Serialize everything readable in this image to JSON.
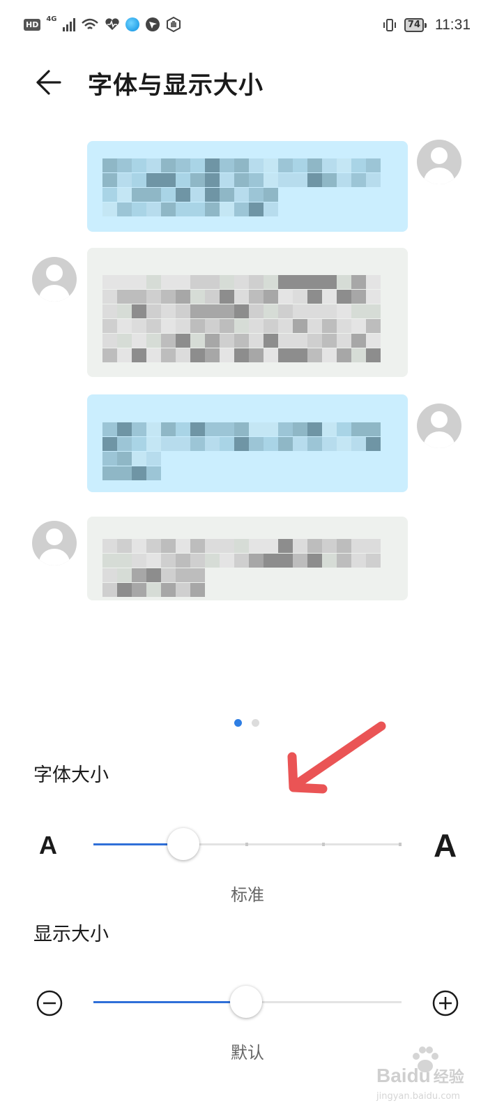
{
  "status_bar": {
    "network_badge": "HD",
    "network_type": "4G",
    "battery": "74",
    "time": "11:31",
    "icons": [
      "hd-icon",
      "signal-icon",
      "wifi-icon",
      "health-icon",
      "browser-icon",
      "location-icon",
      "hand-icon",
      "vibrate-icon",
      "battery-icon"
    ]
  },
  "header": {
    "back_icon": "arrow-left-icon",
    "title": "字体与显示大小"
  },
  "pager": {
    "pages": 2,
    "active_index": 0
  },
  "font_size": {
    "label": "字体大小",
    "small_glyph": "A",
    "large_glyph": "A",
    "value_label": "标准",
    "level": 0.25,
    "steps": 5
  },
  "display_size": {
    "label": "显示大小",
    "minus_icon": "minus-circle-icon",
    "plus_icon": "plus-circle-icon",
    "value_label": "默认",
    "level": 0.5
  },
  "colors": {
    "accent": "#2f6fd8",
    "annotation_arrow": "#ea5455",
    "bubble_sent": "#cbeefe",
    "bubble_received": "#eef1ee"
  },
  "watermark": {
    "brand": "Bai",
    "brand2": "du",
    "suffix": "经验",
    "url": "jingyan.baidu.com"
  }
}
